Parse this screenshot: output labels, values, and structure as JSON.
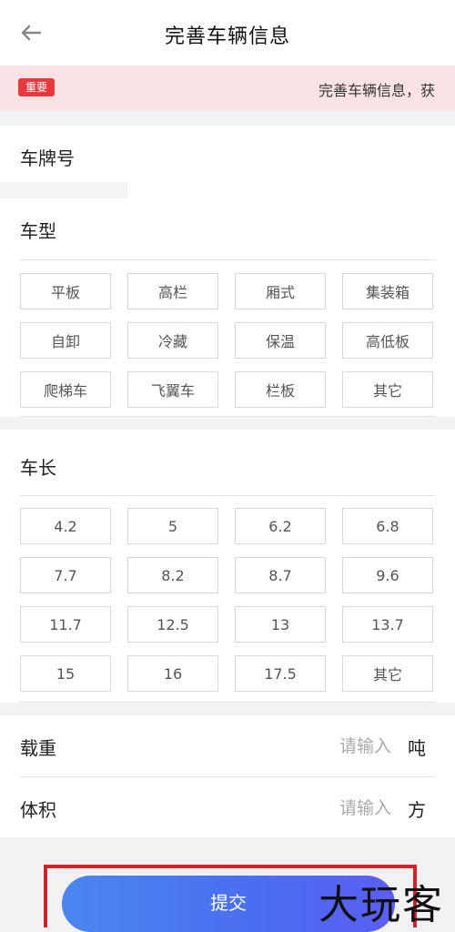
{
  "header": {
    "title": "完善车辆信息",
    "back_icon": "arrow-left-icon"
  },
  "notice": {
    "badge": "重要",
    "text": "完善车辆信息，获"
  },
  "plate": {
    "label": "车牌号"
  },
  "vehicle_type": {
    "label": "车型",
    "options": [
      "平板",
      "高栏",
      "厢式",
      "集装箱",
      "自卸",
      "冷藏",
      "保温",
      "高低板",
      "爬梯车",
      "飞翼车",
      "栏板",
      "其它"
    ]
  },
  "vehicle_length": {
    "label": "车长",
    "options": [
      "4.2",
      "5",
      "6.2",
      "6.8",
      "7.7",
      "8.2",
      "8.7",
      "9.6",
      "11.7",
      "12.5",
      "13",
      "13.7",
      "15",
      "16",
      "17.5",
      "其它"
    ]
  },
  "load": {
    "label": "载重",
    "placeholder": "请输入",
    "unit": "吨"
  },
  "volume": {
    "label": "体积",
    "placeholder": "请输入",
    "unit": "方"
  },
  "submit": {
    "label": "提交"
  },
  "watermark": {
    "text": "大玩客"
  },
  "colors": {
    "accent": "#4a7ff0",
    "badge": "#e8383d",
    "notice_bg": "#fbe3e5",
    "highlight_frame": "#d3232a"
  }
}
